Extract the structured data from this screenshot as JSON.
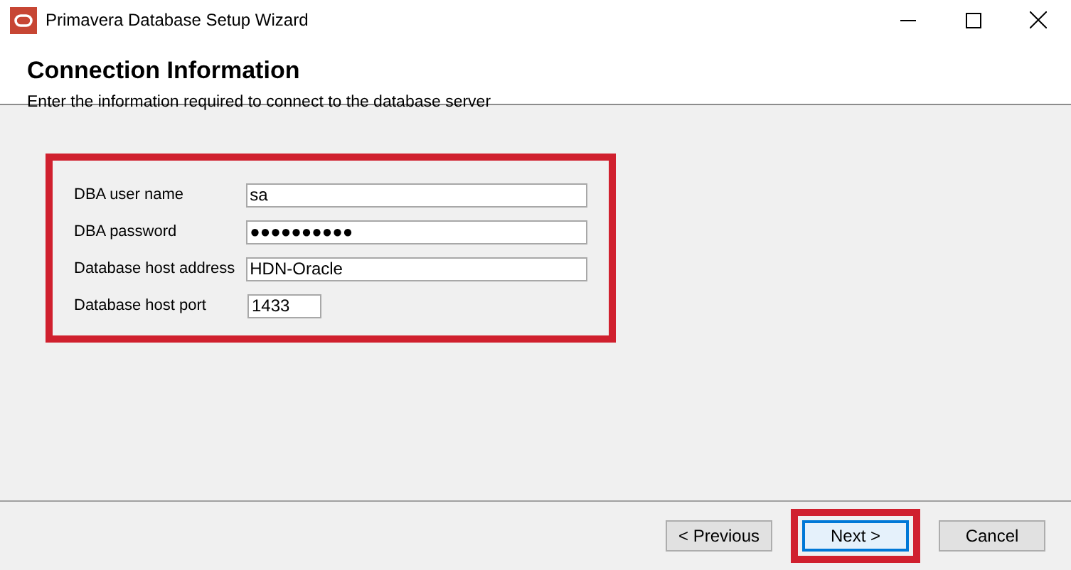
{
  "window": {
    "title": "Primavera Database Setup Wizard"
  },
  "header": {
    "title": "Connection Information",
    "subtitle": "Enter the information required to connect to the database server"
  },
  "form": {
    "highlighted": true,
    "fields": [
      {
        "label": "DBA user name",
        "value": "sa",
        "kind": "wide"
      },
      {
        "label": "DBA password",
        "value": "●●●●●●●●●●",
        "kind": "wide"
      },
      {
        "label": "Database host address",
        "value": "HDN-Oracle",
        "kind": "wide"
      },
      {
        "label": "Database host port",
        "value": "1433",
        "kind": "short"
      }
    ]
  },
  "buttons": [
    {
      "label": "< Previous",
      "focused": false,
      "highlighted": false
    },
    {
      "label": "Next >",
      "focused": true,
      "highlighted": true
    },
    {
      "label": "Cancel",
      "focused": false,
      "highlighted": false
    }
  ]
}
